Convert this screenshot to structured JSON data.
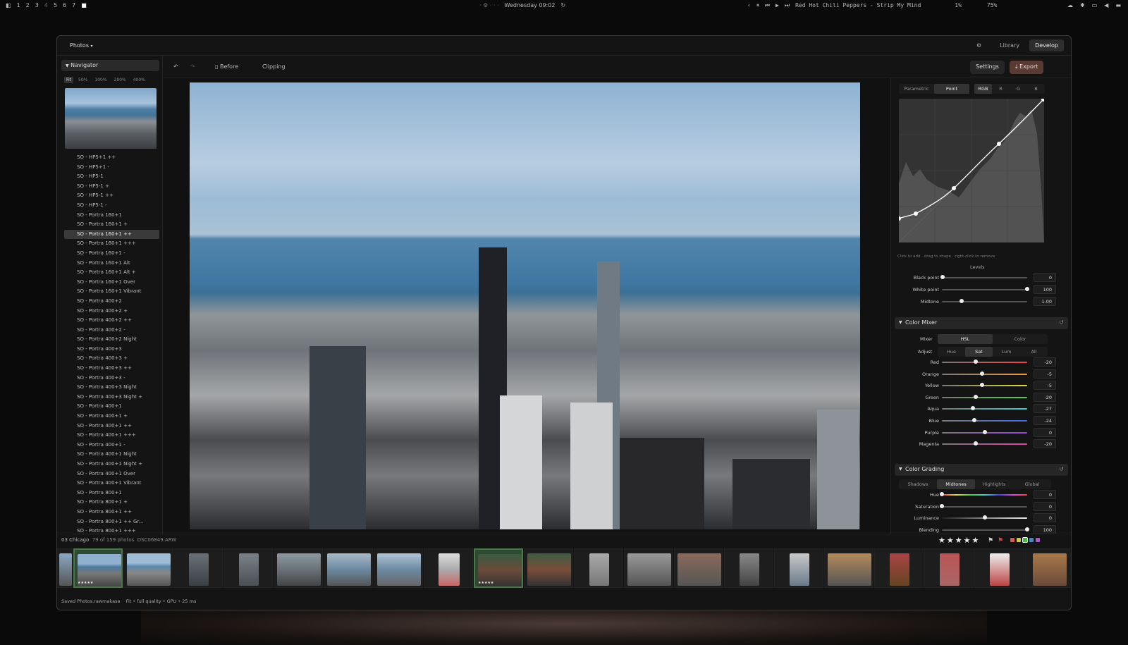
{
  "topbar": {
    "workspaces": [
      "1",
      "2",
      "3",
      "4",
      "5",
      "6",
      "7"
    ],
    "clock": "Wednesday 09:02",
    "now_playing": "Red Hot Chili Peppers - Strip My Mind",
    "cpu": "1%",
    "volume": "75%"
  },
  "app": {
    "name": "Photos",
    "modes": [
      "Library",
      "Develop"
    ],
    "active_mode": "Develop"
  },
  "navigator": {
    "title": "Navigator",
    "zooms": [
      "Fit",
      "50%",
      "100%",
      "200%",
      "400%"
    ],
    "active_zoom": "Fit",
    "presets": [
      "SO - HP5+1 ++",
      "SO - HP5+1 -",
      "SO - HP5-1",
      "SO - HP5-1 +",
      "SO - HP5-1 ++",
      "SO - HP5-1 -",
      "SO - Portra 160+1",
      "SO - Portra 160+1 +",
      "SO - Portra 160+1 ++",
      "SO - Portra 160+1 +++",
      "SO - Portra 160+1 -",
      "SO - Portra 160+1 Alt",
      "SO - Portra 160+1 Alt +",
      "SO - Portra 160+1 Over",
      "SO - Portra 160+1 Vibrant",
      "SO - Portra 400+2",
      "SO - Portra 400+2 +",
      "SO - Portra 400+2 ++",
      "SO - Portra 400+2 -",
      "SO - Portra 400+2 Night",
      "SO - Portra 400+3",
      "SO - Portra 400+3 +",
      "SO - Portra 400+3 ++",
      "SO - Portra 400+3 -",
      "SO - Portra 400+3 Night",
      "SO - Portra 400+3 Night +",
      "SO - Portra 400+1",
      "SO - Portra 400+1 +",
      "SO - Portra 400+1 ++",
      "SO - Portra 400+1 +++",
      "SO - Portra 400+1 -",
      "SO - Portra 400+1 Night",
      "SO - Portra 400+1 Night +",
      "SO - Portra 400+1 Over",
      "SO - Portra 400+1 Vibrant",
      "SO - Portra 800+1",
      "SO - Portra 800+1 +",
      "SO - Portra 800+1 ++",
      "SO - Portra 800+1 ++ Gr...",
      "SO - Portra 800+1 +++"
    ],
    "selected_preset": "SO - Portra 160+1 ++"
  },
  "toolbar": {
    "before": "Before",
    "clipping": "Clipping",
    "settings": "Settings",
    "export": "Export"
  },
  "curve": {
    "modes": [
      "Parametric",
      "Point"
    ],
    "active_mode": "Point",
    "channels": [
      "RGB",
      "R",
      "G",
      "B"
    ],
    "active_channel": "RGB",
    "hint": "Click to add · drag to shape · right-click to remove",
    "levels_title": "Levels",
    "black_point_label": "Black point",
    "black_point": "0",
    "white_point_label": "White point",
    "white_point": "100",
    "midtone_label": "Midtone",
    "midtone": "1.00"
  },
  "color_mixer": {
    "title": "Color Mixer",
    "mixer_label": "Mixer",
    "mixer_modes": [
      "HSL",
      "Color"
    ],
    "active_mixer": "HSL",
    "adjust_label": "Adjust",
    "adjust_modes": [
      "Hue",
      "Sat",
      "Lum",
      "All"
    ],
    "active_adjust": "Sat",
    "rows": [
      {
        "label": "Red",
        "value": "-20"
      },
      {
        "label": "Orange",
        "value": "-5"
      },
      {
        "label": "Yellow",
        "value": "-5"
      },
      {
        "label": "Green",
        "value": "-20"
      },
      {
        "label": "Aqua",
        "value": "-27"
      },
      {
        "label": "Blue",
        "value": "-24"
      },
      {
        "label": "Purple",
        "value": "0"
      },
      {
        "label": "Magenta",
        "value": "-20"
      }
    ]
  },
  "color_grading": {
    "title": "Color Grading",
    "tabs": [
      "Shadows",
      "Midtones",
      "Highlights",
      "Global"
    ],
    "active_tab": "Midtones",
    "rows": [
      {
        "label": "Hue",
        "value": "0"
      },
      {
        "label": "Saturation",
        "value": "0"
      },
      {
        "label": "Luminance",
        "value": "0"
      },
      {
        "label": "Blending",
        "value": "100"
      }
    ]
  },
  "filmstrip": {
    "album": "03 Chicago",
    "count": "79 of 159 photos",
    "filename": "DSC06849.ARW",
    "rating": "★★★★★",
    "thumb_stars": "★★★★★"
  },
  "status": {
    "saved": "Saved Photos.rawmakase",
    "render": "Fit • full quality • GPU • 25 ms"
  }
}
